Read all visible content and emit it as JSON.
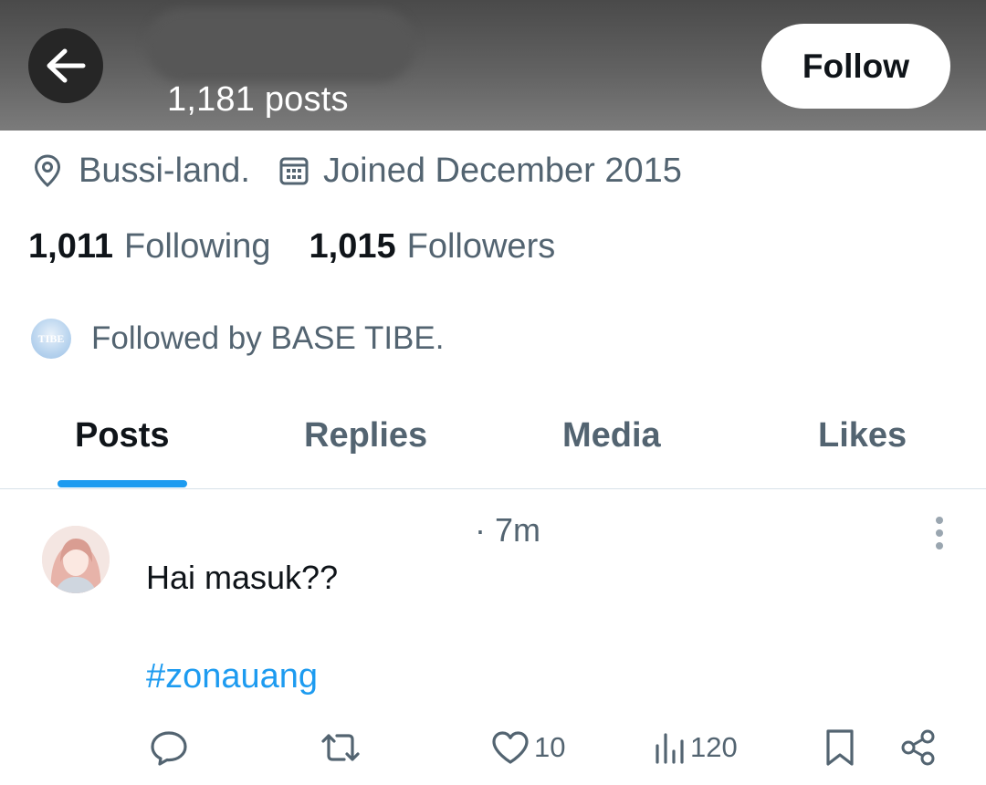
{
  "header": {
    "posts_count": "1,181 posts",
    "follow_label": "Follow"
  },
  "profile": {
    "location": "Bussi-land.",
    "joined": "Joined December 2015",
    "following_count": "1,011",
    "following_label": "Following",
    "followers_count": "1,015",
    "followers_label": "Followers",
    "followed_by": "Followed by BASE TIBE.",
    "followed_by_avatar_text": "TIBE"
  },
  "tabs": [
    {
      "label": "Posts",
      "active": true
    },
    {
      "label": "Replies",
      "active": false
    },
    {
      "label": "Media",
      "active": false
    },
    {
      "label": "Likes",
      "active": false
    }
  ],
  "post": {
    "time": "· 7m",
    "text": "Hai masuk??",
    "hashtag": "#zonauang",
    "likes": "10",
    "views": "120"
  },
  "icons": {
    "back": "arrow-left-icon",
    "location": "location-pin-icon",
    "calendar": "calendar-icon",
    "more": "more-vertical-icon",
    "reply": "reply-icon",
    "repost": "repost-icon",
    "like": "heart-icon",
    "views": "views-icon",
    "bookmark": "bookmark-icon",
    "share": "share-icon"
  },
  "colors": {
    "accent": "#1d9bf0",
    "secondary_text": "#536471",
    "primary_text": "#0f1419"
  }
}
